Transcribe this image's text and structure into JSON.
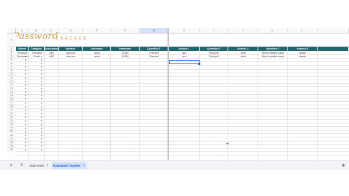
{
  "header": {
    "script_word": "Password",
    "caps_word": "TRACKER"
  },
  "columns": [
    "A",
    "B",
    "C",
    "D",
    "E",
    "F",
    "G",
    "H",
    "I",
    "J",
    "K",
    "L"
  ],
  "table": {
    "headers": [
      "Owner",
      "Category",
      "Description",
      "Website",
      "Username",
      "Password",
      "Question 1",
      "Answer 1",
      "Question 2",
      "Answer 2",
      "Question 3",
      "Answer 3"
    ],
    "rows": [
      [
        "Person A",
        "Children",
        "ABC",
        "abc.com",
        "abcd",
        "12345",
        "First car?",
        "abc",
        "First pet?",
        "abcd",
        "Mom's maiden name",
        "abcde"
      ],
      [
        "Business A",
        "Email",
        "ABC",
        "abc.com",
        "abcd",
        "12345",
        "First car?",
        "abc",
        "First pet?",
        "abcd",
        "Mom's maiden name",
        "abcde"
      ]
    ],
    "row_numbers": [
      "1",
      "2",
      "3",
      "4",
      "5",
      "6",
      "7",
      "8",
      "9",
      "10",
      "11",
      "12",
      "13",
      "14",
      "15",
      "16",
      "17",
      "18",
      "19",
      "20",
      "21",
      "22",
      "23",
      "24",
      "25",
      "26",
      "27",
      "28",
      "29",
      "30"
    ]
  },
  "tabs": {
    "add_icon": "+",
    "menu_icon": "≡",
    "start_here": "Start Here",
    "password_tracker": "Password Tracker",
    "explore_icon": "✚"
  },
  "colors": {
    "header_teal": "#1f6670",
    "script_gold": "#c9a24a",
    "selection_blue": "#1a73e8"
  }
}
